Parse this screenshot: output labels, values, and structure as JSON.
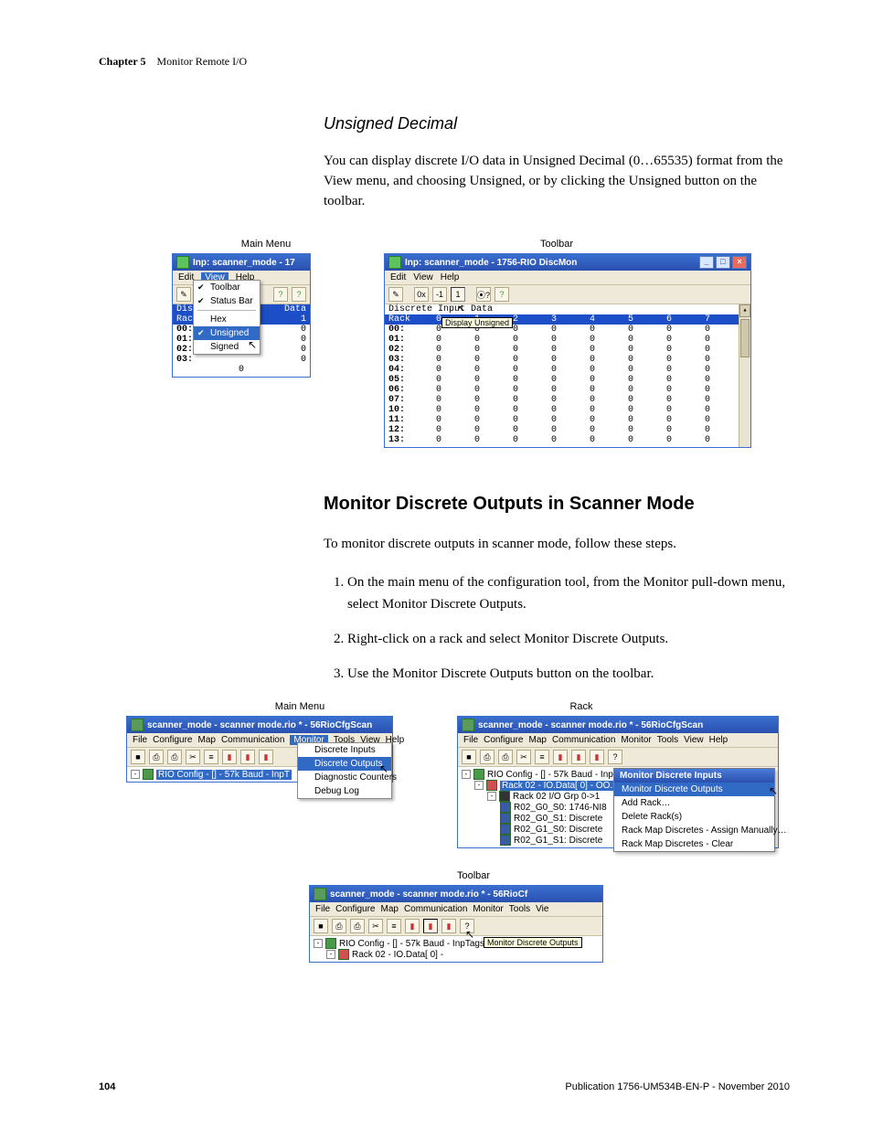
{
  "header": {
    "chapter": "Chapter 5",
    "title": "Monitor Remote I/O"
  },
  "section1": {
    "heading": "Unsigned Decimal",
    "para": "You can display discrete I/O data in Unsigned Decimal (0…65535) format from the View menu, and choosing Unsigned, or by clicking the Unsigned button on the toolbar."
  },
  "labels": {
    "main_menu": "Main Menu",
    "toolbar": "Toolbar",
    "rack": "Rack"
  },
  "view_menu_win": {
    "title": "Inp: scanner_mode - 17",
    "menus": [
      "Edit",
      "View",
      "Help"
    ],
    "view_items": {
      "toolbar": "Toolbar",
      "statusbar": "Status Bar",
      "hex": "Hex",
      "unsigned": "Unsigned",
      "signed": "Signed"
    },
    "header_left": "Disc",
    "header_right": "Data",
    "rack_label": "Rack",
    "rows": [
      "00:",
      "01:",
      "02:",
      "03:"
    ],
    "ones": [
      "1"
    ],
    "zeros_tail": [
      "0",
      "0",
      "0",
      "0"
    ],
    "bottom_zero": "0"
  },
  "toolbar_win": {
    "title": "Inp: scanner_mode - 1756-RIO DiscMon",
    "menus": [
      "Edit",
      "View",
      "Help"
    ],
    "tool_labels": [
      "0x",
      "-1",
      "1"
    ],
    "header_label": "Discrete Input Data",
    "rack_label": "Rack",
    "col_head": [
      "0",
      "1",
      "2",
      "3",
      "4",
      "5",
      "6",
      "7"
    ],
    "tooltip": "Display Unsigned",
    "rows": [
      {
        "r": "00:",
        "d": [
          "0",
          "0",
          "0",
          "0",
          "0",
          "0",
          "0",
          "0"
        ]
      },
      {
        "r": "01:",
        "d": [
          "0",
          "0",
          "0",
          "0",
          "0",
          "0",
          "0",
          "0"
        ]
      },
      {
        "r": "02:",
        "d": [
          "0",
          "0",
          "0",
          "0",
          "0",
          "0",
          "0",
          "0"
        ]
      },
      {
        "r": "03:",
        "d": [
          "0",
          "0",
          "0",
          "0",
          "0",
          "0",
          "0",
          "0"
        ]
      },
      {
        "r": "04:",
        "d": [
          "0",
          "0",
          "0",
          "0",
          "0",
          "0",
          "0",
          "0"
        ]
      },
      {
        "r": "05:",
        "d": [
          "0",
          "0",
          "0",
          "0",
          "0",
          "0",
          "0",
          "0"
        ]
      },
      {
        "r": "06:",
        "d": [
          "0",
          "0",
          "0",
          "0",
          "0",
          "0",
          "0",
          "0"
        ]
      },
      {
        "r": "07:",
        "d": [
          "0",
          "0",
          "0",
          "0",
          "0",
          "0",
          "0",
          "0"
        ]
      },
      {
        "r": "10:",
        "d": [
          "0",
          "0",
          "0",
          "0",
          "0",
          "0",
          "0",
          "0"
        ]
      },
      {
        "r": "11:",
        "d": [
          "0",
          "0",
          "0",
          "0",
          "0",
          "0",
          "0",
          "0"
        ]
      },
      {
        "r": "12:",
        "d": [
          "0",
          "0",
          "0",
          "0",
          "0",
          "0",
          "0",
          "0"
        ]
      },
      {
        "r": "13:",
        "d": [
          "0",
          "0",
          "0",
          "0",
          "0",
          "0",
          "0",
          "0"
        ]
      }
    ]
  },
  "section2": {
    "heading": "Monitor Discrete Outputs in Scanner Mode",
    "intro": "To monitor discrete outputs in scanner mode, follow these steps.",
    "steps": [
      "On the main menu of the configuration tool, from the Monitor pull-down menu, select Monitor Discrete Outputs.",
      "Right-click on a rack and select Monitor Discrete Outputs.",
      "Use the Monitor Discrete Outputs button on the toolbar."
    ]
  },
  "cfg_win": {
    "title": "scanner_mode - scanner mode.rio * - 56RioCfgScan",
    "menus": [
      "File",
      "Configure",
      "Map",
      "Communication",
      "Monitor",
      "Tools",
      "View",
      "Help"
    ],
    "monitor_menu": [
      "Discrete Inputs",
      "Discrete Outputs",
      "Diagnostic Counters",
      "Debug Log"
    ],
    "tree_root": "RIO Config - [] - 57k Baud - InpT"
  },
  "rack_win": {
    "title": "scanner_mode - scanner mode.rio * - 56RioCfgScan",
    "menus": [
      "File",
      "Configure",
      "Map",
      "Communication",
      "Monitor",
      "Tools",
      "View",
      "Help"
    ],
    "tree": {
      "root": "RIO Config - [] - 57k Baud - InpTags:1 OutTags:1",
      "rack_sel": "Rack 02 - IO.Data[  0] - OO.Da",
      "grp": "Rack 02 I/O Grp 0->1",
      "items": [
        "R02_G0_S0: 1746-NI8",
        "R02_G0_S1: Discrete",
        "R02_G1_S0: Discrete",
        "R02_G1_S1: Discrete"
      ]
    },
    "ctx": {
      "head": "Monitor Discrete Inputs",
      "sel": "Monitor Discrete Outputs",
      "items": [
        "Add Rack…",
        "Delete Rack(s)",
        "Rack Map Discretes - Assign Manually…",
        "Rack Map Discretes - Clear"
      ]
    }
  },
  "tool_win": {
    "title": "scanner_mode - scanner mode.rio * - 56RioCf",
    "menus": [
      "File",
      "Configure",
      "Map",
      "Communication",
      "Monitor",
      "Tools",
      "Vie"
    ],
    "tree_root": "RIO Config - [] - 57k Baud - InpTags:1 OutTags:1",
    "tree_rack": "Rack 02 - IO.Data[  0] -",
    "tooltip": "Monitor Discrete Outputs"
  },
  "footer": {
    "page": "104",
    "pub": "Publication 1756-UM534B-EN-P - November 2010"
  }
}
